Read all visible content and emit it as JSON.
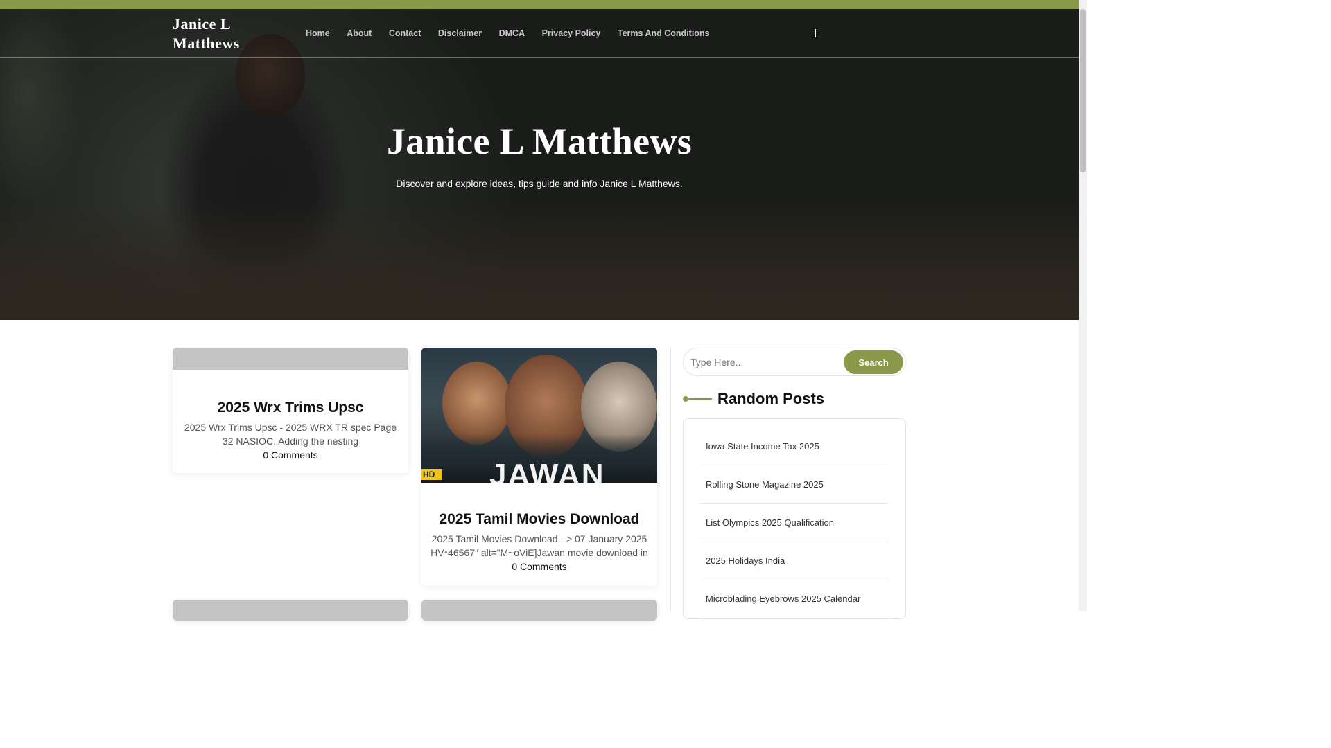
{
  "colors": {
    "accent": "#8a9a4a",
    "hero_text": "#ffffff"
  },
  "site": {
    "title": "Janice L Matthews"
  },
  "nav": {
    "items": [
      "Home",
      "About",
      "Contact",
      "Disclaimer",
      "DMCA",
      "Privacy Policy",
      "Terms And Conditions"
    ]
  },
  "hero": {
    "title": "Janice L Matthews",
    "subtitle": "Discover and explore ideas, tips guide and info Janice L Matthews."
  },
  "posts": [
    {
      "title": "2025 Wrx Trims Upsc",
      "excerpt": "2025 Wrx Trims Upsc - 2025 WRX TR spec Page 32 NASIOC, Adding the nesting",
      "comments": "0 Comments"
    },
    {
      "title": "2025 Tamil Movies Download",
      "excerpt": "2025 Tamil Movies Download - > 07 January 2025 HV*46567″ alt=”M~oViE]Jawan movie download in",
      "comments": "0 Comments",
      "thumbnail": {
        "title_text": "JAWAN",
        "badge": "HD"
      }
    }
  ],
  "sidebar": {
    "search": {
      "placeholder": "Type Here...",
      "button_label": "Search"
    },
    "random_posts": {
      "title": "Random Posts",
      "items": [
        "Iowa State Income Tax 2025",
        "Rolling Stone Magazine 2025",
        "List Olympics 2025 Qualification",
        "2025 Holidays India",
        "Microblading Eyebrows 2025 Calendar"
      ]
    }
  },
  "icons": {
    "search_toggle": "search-toggle-icon"
  }
}
